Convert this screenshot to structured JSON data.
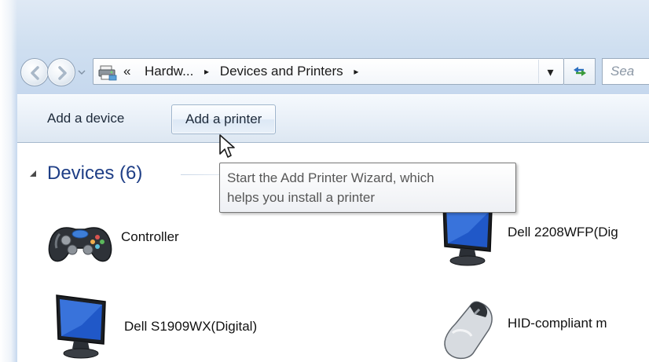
{
  "navigation": {
    "breadcrumb": {
      "overflow_glyph": "«",
      "items": [
        "Hardw...",
        "Devices and Printers"
      ],
      "separator": "▸"
    },
    "address_dropdown_glyph": "▾",
    "search_placeholder": "Sea",
    "icons": {
      "back": "back-arrow-icon",
      "forward": "forward-arrow-icon",
      "history": "chevron-down-icon",
      "location": "printer-folder-icon",
      "refresh": "refresh-icon"
    }
  },
  "command_bar": {
    "add_device": "Add a device",
    "add_printer": "Add a printer"
  },
  "devices_group": {
    "title": "Devices (6)",
    "collapse_glyph": "◢",
    "items": [
      {
        "label": "Controller",
        "icon": "gamepad-icon"
      },
      {
        "label": "Dell 2208WFP(Dig",
        "icon": "monitor-icon"
      },
      {
        "label": "Dell S1909WX(Digital)",
        "icon": "monitor-icon"
      },
      {
        "label": "HID-compliant m",
        "icon": "mouse-icon"
      }
    ]
  },
  "tooltip": {
    "line1": "Start the Add Printer Wizard, which",
    "line2": "helps you install a printer"
  },
  "colors": {
    "group_title": "#1e3e86",
    "tooltip_text": "#575757",
    "command_bar": "#e9f0f8"
  }
}
